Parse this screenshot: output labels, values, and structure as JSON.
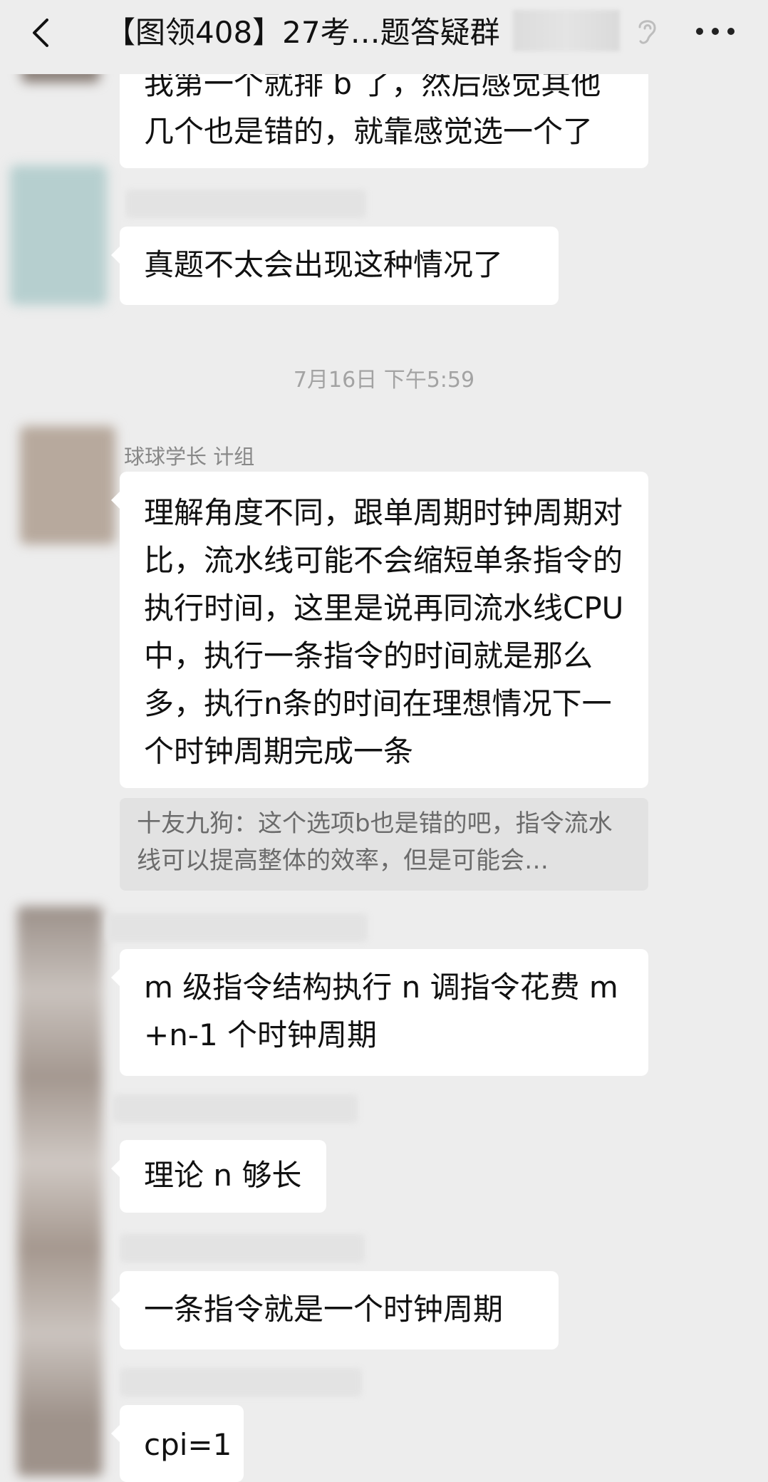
{
  "header": {
    "title": "【图领408】27考…题答疑群",
    "back_icon": "chevron-left-icon",
    "ear_icon": "ear-icon",
    "more_icon": "more-dots-icon"
  },
  "messages": {
    "m1_text": "我第一个就排 b 了，然后感觉其他几个也是错的，就靠感觉选一个了",
    "m2_text": "真题不太会出现这种情况了",
    "timestamp": "7月16日 下午5:59",
    "m3_sender": "球球学长 计组",
    "m3_text": "理解角度不同，跟单周期时钟周期对比，流水线可能不会缩短单条指令的执行时间，这里是说再同流水线CPU中，执行一条指令的时间就是那么多，执行n条的时间在理想情况下一个时钟周期完成一条",
    "m3_quote": "十友九狗：这个选项b也是错的吧，指令流水线可以提高整体的效率，但是可能会…",
    "m4_text": "m 级指令结构执行 n 调指令花费 m +n-1 个时钟周期",
    "m5_text": "理论 n 够长",
    "m6_text": "一条指令就是一个时钟周期",
    "m7_text": "cpi=1"
  },
  "colors": {
    "background": "#ededed",
    "bubble": "#ffffff",
    "quote_bg": "#e2e2e2",
    "timestamp": "#a3a3a3"
  }
}
